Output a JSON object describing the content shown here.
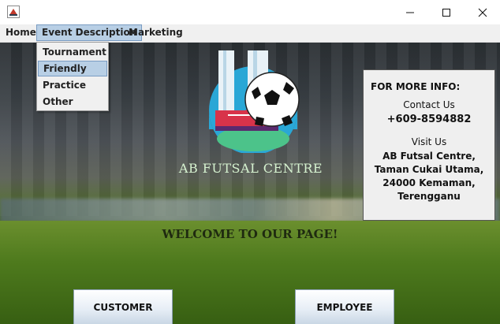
{
  "window": {
    "controls": [
      "minimize",
      "maximize",
      "close"
    ]
  },
  "menu": {
    "items": [
      "Home",
      "Event Description",
      "Marketing"
    ],
    "active": "Event Description",
    "dropdown": [
      "Tournament",
      "Friendly",
      "Practice",
      "Other"
    ],
    "highlighted": "Friendly"
  },
  "brand": "AB FUTSAL CENTRE",
  "welcome": "WELCOME TO OUR PAGE!",
  "info": {
    "heading": "FOR MORE INFO:",
    "contact_label": "Contact Us",
    "phone": "+609-8594882",
    "visit_label": "Visit Us",
    "address_lines": [
      "AB Futsal Centre,",
      "Taman Cukai Utama,",
      "24000 Kemaman,",
      "Terengganu"
    ]
  },
  "buttons": {
    "customer": "CUSTOMER",
    "employee": "EMPLOYEE"
  },
  "colors": {
    "menu_highlight": "#b8cfe5",
    "logo_circle": "#2aa7d6",
    "brand_text": "#d6f2d0"
  }
}
